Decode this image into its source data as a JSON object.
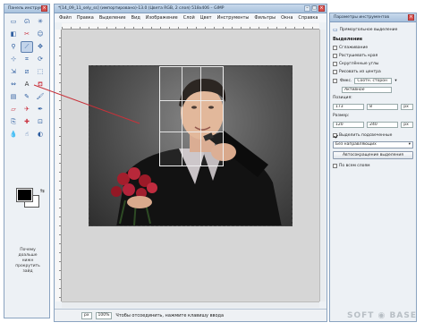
{
  "toolbox": {
    "title": "Панель инструм...",
    "hint": "Почему\nдоальше\nнижн\nпрокрутить\nзайд",
    "tools": [
      {
        "icon": "rect-select-icon",
        "glyph": "▭"
      },
      {
        "icon": "lasso-icon",
        "glyph": "ᘏ"
      },
      {
        "icon": "fuzzy-select-icon",
        "glyph": "✳"
      },
      {
        "icon": "color-select-icon",
        "glyph": "◧"
      },
      {
        "icon": "scissors-icon",
        "glyph": "✂"
      },
      {
        "icon": "foreground-select-icon",
        "glyph": "☺"
      },
      {
        "icon": "magnify-icon",
        "glyph": "⚲"
      },
      {
        "icon": "measure-icon",
        "glyph": "⟋"
      },
      {
        "icon": "move-icon",
        "glyph": "✥"
      },
      {
        "icon": "align-icon",
        "glyph": "⊹"
      },
      {
        "icon": "crop-icon",
        "glyph": "⌗"
      },
      {
        "icon": "rotate-icon",
        "glyph": "⟳"
      },
      {
        "icon": "scale-icon",
        "glyph": "⇲"
      },
      {
        "icon": "shear-icon",
        "glyph": "⧄"
      },
      {
        "icon": "perspective-icon",
        "glyph": "⬚"
      },
      {
        "icon": "flip-icon",
        "glyph": "⇔"
      },
      {
        "icon": "text-icon",
        "glyph": "A"
      },
      {
        "icon": "bucket-icon",
        "glyph": "⛾"
      },
      {
        "icon": "blend-icon",
        "glyph": "▤"
      },
      {
        "icon": "pencil-icon",
        "glyph": "✎"
      },
      {
        "icon": "brush-icon",
        "glyph": "🖌"
      },
      {
        "icon": "eraser-icon",
        "glyph": "▱"
      },
      {
        "icon": "airbrush-icon",
        "glyph": "✈"
      },
      {
        "icon": "ink-icon",
        "glyph": "✒"
      },
      {
        "icon": "clone-icon",
        "glyph": "⎘"
      },
      {
        "icon": "heal-icon",
        "glyph": "✚"
      },
      {
        "icon": "perspective-clone-icon",
        "glyph": "⊡"
      },
      {
        "icon": "blur-icon",
        "glyph": "💧"
      },
      {
        "icon": "smudge-icon",
        "glyph": "☝"
      },
      {
        "icon": "dodge-icon",
        "glyph": "◐"
      }
    ]
  },
  "main": {
    "title": "*[14_09_11_sely_ss] (импортировано)-13.0 (Цвета RGB, 2 слоя) 518x406 – GIMP",
    "menu": [
      "Файл",
      "Правка",
      "Выделение",
      "Вид",
      "Изображение",
      "Слой",
      "Цвет",
      "Инструменты",
      "Фильтры",
      "Окна",
      "Справка"
    ],
    "status": {
      "unit": "px",
      "zoom": "100%",
      "message": "Чтобы отсоединить, нажмите клавишу ввода"
    }
  },
  "options": {
    "title": "Параметры инструментов",
    "subtitle": "Прямоугольное выделение",
    "section_select": "Выделение",
    "chk_antialias": "Сглаживание",
    "chk_feather": "Растушевать края",
    "chk_round": "Скруглённые углы",
    "chk_expand": "Рисовать из центра",
    "chk_fixed": "Фикс.",
    "fixed_value": "Соотн. сторон",
    "mode_value": "Активное",
    "label_position": "Позиция:",
    "pos_x": "173",
    "pos_y": "8",
    "label_size": "Размер:",
    "size_w": "120",
    "size_h": "240",
    "unit": "px",
    "chk_guides": "Выделить подсвеченные",
    "guides_select": "Без направляющих",
    "btn_autoshrink": "Автосокращение выделения",
    "chk_merged": "По всем слоям"
  },
  "watermark": "SOFT ◉ BASE"
}
